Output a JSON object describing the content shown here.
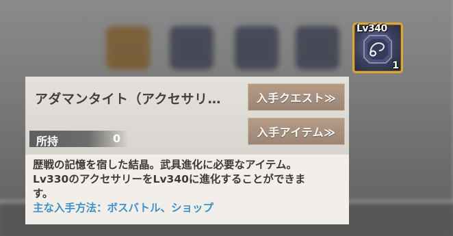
{
  "item_icon": {
    "level_tag": "Lv340",
    "count": "1",
    "icon": "gem-necklace-icon"
  },
  "tooltip": {
    "item_name": "アダマンタイト（アクセサリ…",
    "owned_label": "所持",
    "owned_value": "0",
    "quest_button": "入手クエスト≫",
    "item_button": "入手アイテム≫",
    "description_line1": "歴戦の記憶を宿した結晶。武具進化に必要なアイテム。",
    "description_line2": "Lv330のアクセサリーをLv340に進化することができま",
    "description_line3": "す。",
    "obtain_method": "主な入手方法：ボスバトル、ショップ"
  },
  "colors": {
    "icon_border": "#d9a73a",
    "button_bg": "#a88f7c",
    "obtain_text": "#3f8fc8"
  }
}
